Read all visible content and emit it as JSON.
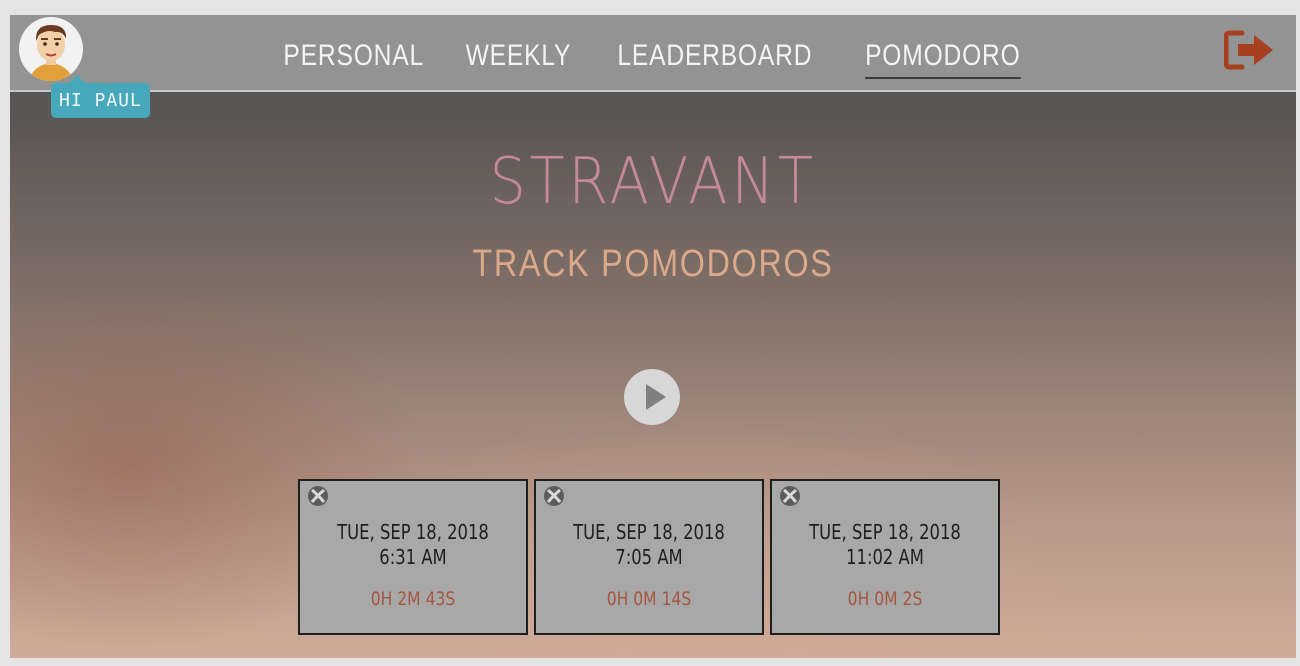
{
  "header": {
    "greeting": "HI PAUL",
    "nav": [
      {
        "label": "PERSONAL",
        "active": false
      },
      {
        "label": "WEEKLY",
        "active": false
      },
      {
        "label": "LEADERBOARD",
        "active": false
      },
      {
        "label": "POMODORO",
        "active": true
      }
    ],
    "avatar_icon": "user-avatar",
    "logout_icon": "logout-arrow-icon",
    "logout_color": "#a6401f"
  },
  "hero": {
    "logo": "STRAVANT",
    "subtitle": "TRACK POMODOROS",
    "play_icon": "play-icon"
  },
  "sessions": [
    {
      "date": "TUE, SEP 18, 2018",
      "time": "6:31 AM",
      "duration": "0H 2M 43S"
    },
    {
      "date": "TUE, SEP 18, 2018",
      "time": "7:05 AM",
      "duration": "0H 0M 14S"
    },
    {
      "date": "TUE, SEP 18, 2018",
      "time": "11:02 AM",
      "duration": "0H 0M 2S"
    }
  ],
  "colors": {
    "topbar": "#939393",
    "greeting_bg": "#47a7bb",
    "logo": "#c48a98",
    "subtitle": "#dca88a",
    "duration": "#a3573f",
    "card_bg": "#a9a8a9"
  }
}
